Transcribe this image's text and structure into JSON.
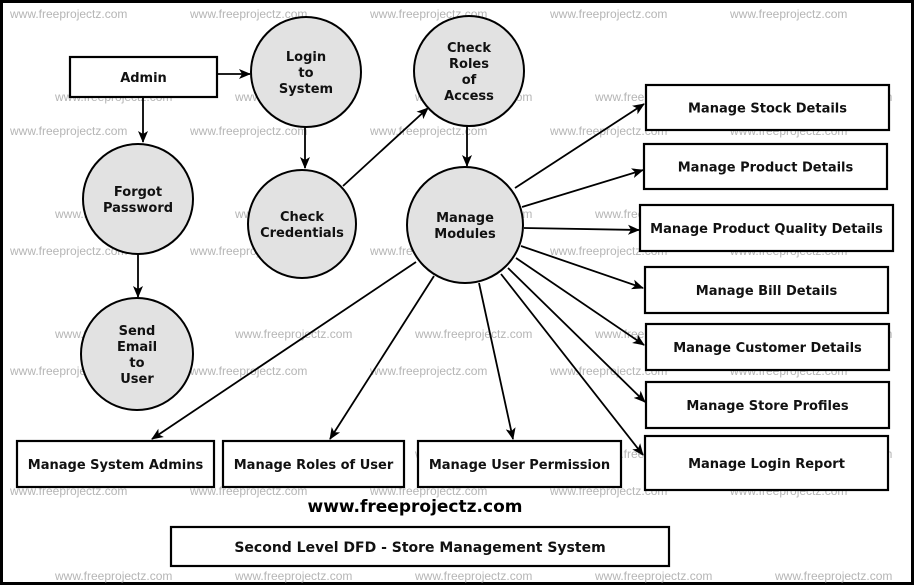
{
  "diagram": {
    "title": "Second Level DFD - Store Management System",
    "website": "www.freeprojectz.com",
    "watermark": "www.freeprojectz.com",
    "colors": {
      "process_fill": "#e2e2e2",
      "entity_fill": "#ffffff",
      "stroke": "#000000",
      "watermark": "#b5b5b5"
    },
    "entities": [
      {
        "id": "admin",
        "label": "Admin"
      },
      {
        "id": "stock",
        "label": "Manage Stock Details"
      },
      {
        "id": "product",
        "label": "Manage Product Details"
      },
      {
        "id": "quality",
        "label": "Manage Product Quality Details"
      },
      {
        "id": "bill",
        "label": "Manage Bill Details"
      },
      {
        "id": "customer",
        "label": "Manage Customer Details"
      },
      {
        "id": "store",
        "label": "Manage Store Profiles"
      },
      {
        "id": "loginreport",
        "label": "Manage Login Report"
      },
      {
        "id": "sysadmins",
        "label": "Manage System Admins"
      },
      {
        "id": "roles",
        "label": "Manage Roles of User"
      },
      {
        "id": "permission",
        "label": "Manage User Permission"
      }
    ],
    "processes": [
      {
        "id": "login",
        "lines": [
          "Login",
          "to",
          "System"
        ]
      },
      {
        "id": "checkroles",
        "lines": [
          "Check",
          "Roles",
          "of",
          "Access"
        ]
      },
      {
        "id": "forgot",
        "lines": [
          "Forgot",
          "Password"
        ]
      },
      {
        "id": "credentials",
        "lines": [
          "Check",
          "Credentials"
        ]
      },
      {
        "id": "modules",
        "lines": [
          "Manage",
          "Modules"
        ]
      },
      {
        "id": "sendemail",
        "lines": [
          "Send",
          "Email",
          "to",
          "User"
        ]
      }
    ],
    "flows": [
      {
        "from": "admin",
        "to": "login"
      },
      {
        "from": "admin",
        "to": "forgot"
      },
      {
        "from": "login",
        "to": "credentials"
      },
      {
        "from": "credentials",
        "to": "checkroles"
      },
      {
        "from": "checkroles",
        "to": "modules"
      },
      {
        "from": "forgot",
        "to": "sendemail"
      },
      {
        "from": "modules",
        "to": "stock"
      },
      {
        "from": "modules",
        "to": "product"
      },
      {
        "from": "modules",
        "to": "quality"
      },
      {
        "from": "modules",
        "to": "bill"
      },
      {
        "from": "modules",
        "to": "customer"
      },
      {
        "from": "modules",
        "to": "store"
      },
      {
        "from": "modules",
        "to": "loginreport"
      },
      {
        "from": "modules",
        "to": "sysadmins"
      },
      {
        "from": "modules",
        "to": "roles"
      },
      {
        "from": "modules",
        "to": "permission"
      }
    ]
  }
}
